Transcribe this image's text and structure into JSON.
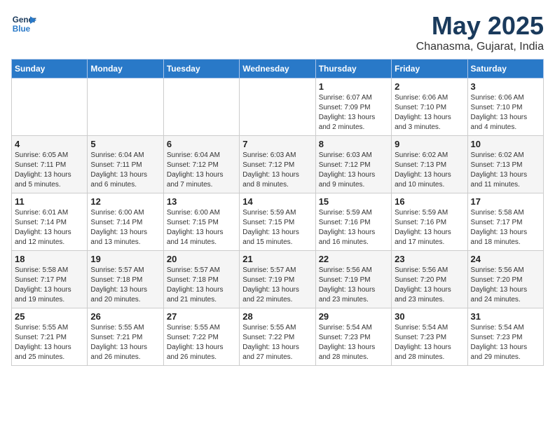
{
  "logo": {
    "line1": "General",
    "line2": "Blue"
  },
  "title": "May 2025",
  "subtitle": "Chanasma, Gujarat, India",
  "weekdays": [
    "Sunday",
    "Monday",
    "Tuesday",
    "Wednesday",
    "Thursday",
    "Friday",
    "Saturday"
  ],
  "weeks": [
    [
      {
        "day": "",
        "info": ""
      },
      {
        "day": "",
        "info": ""
      },
      {
        "day": "",
        "info": ""
      },
      {
        "day": "",
        "info": ""
      },
      {
        "day": "1",
        "info": "Sunrise: 6:07 AM\nSunset: 7:09 PM\nDaylight: 13 hours and 2 minutes."
      },
      {
        "day": "2",
        "info": "Sunrise: 6:06 AM\nSunset: 7:10 PM\nDaylight: 13 hours and 3 minutes."
      },
      {
        "day": "3",
        "info": "Sunrise: 6:06 AM\nSunset: 7:10 PM\nDaylight: 13 hours and 4 minutes."
      }
    ],
    [
      {
        "day": "4",
        "info": "Sunrise: 6:05 AM\nSunset: 7:11 PM\nDaylight: 13 hours and 5 minutes."
      },
      {
        "day": "5",
        "info": "Sunrise: 6:04 AM\nSunset: 7:11 PM\nDaylight: 13 hours and 6 minutes."
      },
      {
        "day": "6",
        "info": "Sunrise: 6:04 AM\nSunset: 7:12 PM\nDaylight: 13 hours and 7 minutes."
      },
      {
        "day": "7",
        "info": "Sunrise: 6:03 AM\nSunset: 7:12 PM\nDaylight: 13 hours and 8 minutes."
      },
      {
        "day": "8",
        "info": "Sunrise: 6:03 AM\nSunset: 7:12 PM\nDaylight: 13 hours and 9 minutes."
      },
      {
        "day": "9",
        "info": "Sunrise: 6:02 AM\nSunset: 7:13 PM\nDaylight: 13 hours and 10 minutes."
      },
      {
        "day": "10",
        "info": "Sunrise: 6:02 AM\nSunset: 7:13 PM\nDaylight: 13 hours and 11 minutes."
      }
    ],
    [
      {
        "day": "11",
        "info": "Sunrise: 6:01 AM\nSunset: 7:14 PM\nDaylight: 13 hours and 12 minutes."
      },
      {
        "day": "12",
        "info": "Sunrise: 6:00 AM\nSunset: 7:14 PM\nDaylight: 13 hours and 13 minutes."
      },
      {
        "day": "13",
        "info": "Sunrise: 6:00 AM\nSunset: 7:15 PM\nDaylight: 13 hours and 14 minutes."
      },
      {
        "day": "14",
        "info": "Sunrise: 5:59 AM\nSunset: 7:15 PM\nDaylight: 13 hours and 15 minutes."
      },
      {
        "day": "15",
        "info": "Sunrise: 5:59 AM\nSunset: 7:16 PM\nDaylight: 13 hours and 16 minutes."
      },
      {
        "day": "16",
        "info": "Sunrise: 5:59 AM\nSunset: 7:16 PM\nDaylight: 13 hours and 17 minutes."
      },
      {
        "day": "17",
        "info": "Sunrise: 5:58 AM\nSunset: 7:17 PM\nDaylight: 13 hours and 18 minutes."
      }
    ],
    [
      {
        "day": "18",
        "info": "Sunrise: 5:58 AM\nSunset: 7:17 PM\nDaylight: 13 hours and 19 minutes."
      },
      {
        "day": "19",
        "info": "Sunrise: 5:57 AM\nSunset: 7:18 PM\nDaylight: 13 hours and 20 minutes."
      },
      {
        "day": "20",
        "info": "Sunrise: 5:57 AM\nSunset: 7:18 PM\nDaylight: 13 hours and 21 minutes."
      },
      {
        "day": "21",
        "info": "Sunrise: 5:57 AM\nSunset: 7:19 PM\nDaylight: 13 hours and 22 minutes."
      },
      {
        "day": "22",
        "info": "Sunrise: 5:56 AM\nSunset: 7:19 PM\nDaylight: 13 hours and 23 minutes."
      },
      {
        "day": "23",
        "info": "Sunrise: 5:56 AM\nSunset: 7:20 PM\nDaylight: 13 hours and 23 minutes."
      },
      {
        "day": "24",
        "info": "Sunrise: 5:56 AM\nSunset: 7:20 PM\nDaylight: 13 hours and 24 minutes."
      }
    ],
    [
      {
        "day": "25",
        "info": "Sunrise: 5:55 AM\nSunset: 7:21 PM\nDaylight: 13 hours and 25 minutes."
      },
      {
        "day": "26",
        "info": "Sunrise: 5:55 AM\nSunset: 7:21 PM\nDaylight: 13 hours and 26 minutes."
      },
      {
        "day": "27",
        "info": "Sunrise: 5:55 AM\nSunset: 7:22 PM\nDaylight: 13 hours and 26 minutes."
      },
      {
        "day": "28",
        "info": "Sunrise: 5:55 AM\nSunset: 7:22 PM\nDaylight: 13 hours and 27 minutes."
      },
      {
        "day": "29",
        "info": "Sunrise: 5:54 AM\nSunset: 7:23 PM\nDaylight: 13 hours and 28 minutes."
      },
      {
        "day": "30",
        "info": "Sunrise: 5:54 AM\nSunset: 7:23 PM\nDaylight: 13 hours and 28 minutes."
      },
      {
        "day": "31",
        "info": "Sunrise: 5:54 AM\nSunset: 7:23 PM\nDaylight: 13 hours and 29 minutes."
      }
    ]
  ]
}
